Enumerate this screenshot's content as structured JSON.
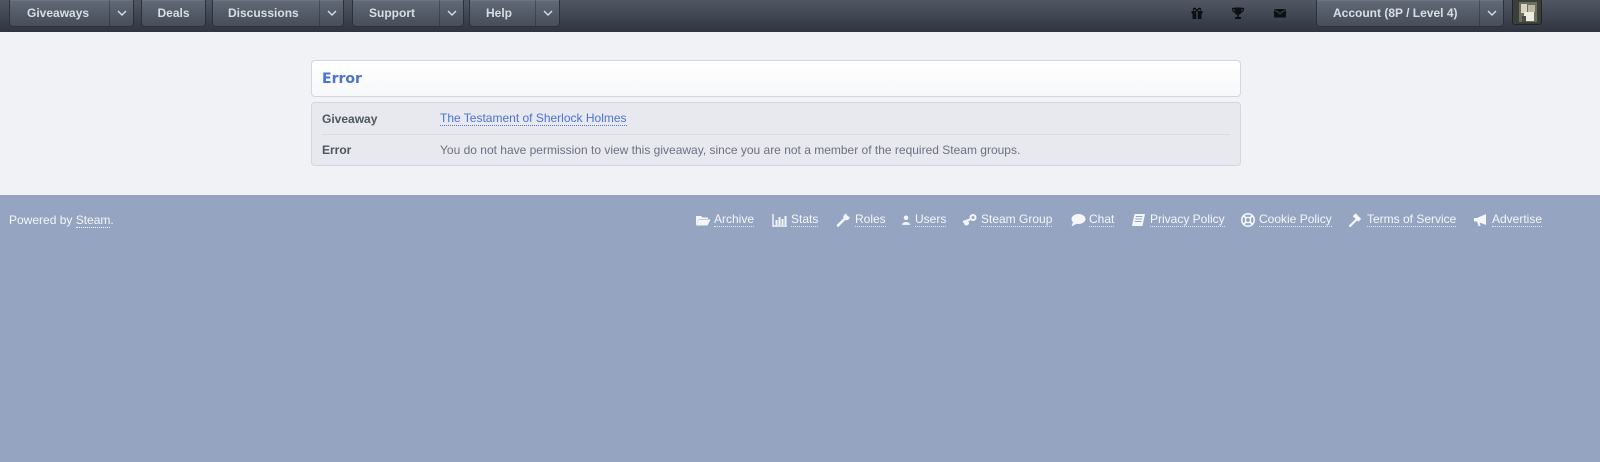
{
  "header": {
    "nav": [
      {
        "label": "Giveaways",
        "has_dropdown": true
      },
      {
        "label": "Deals",
        "has_dropdown": false
      },
      {
        "label": "Discussions",
        "has_dropdown": true
      },
      {
        "label": "Support",
        "has_dropdown": true
      },
      {
        "label": "Help",
        "has_dropdown": true
      }
    ],
    "icons": [
      "gift-icon",
      "trophy-icon",
      "envelope-icon"
    ],
    "account_label": "Account (8P / Level 4)"
  },
  "page": {
    "heading": "Error",
    "rows": [
      {
        "key": "Giveaway",
        "value": "The Testament of Sherlock Holmes"
      },
      {
        "key": "Error",
        "value": "You do not have permission to view this giveaway, since you are not a member of the required Steam groups."
      }
    ]
  },
  "footer": {
    "powered_prefix": "Powered by ",
    "powered_link": "Steam",
    "powered_suffix": ".",
    "links": [
      "Archive",
      "Stats",
      "Roles",
      "Users",
      "Steam Group",
      "Chat",
      "Privacy Policy",
      "Cookie Policy",
      "Terms of Service",
      "Advertise"
    ]
  },
  "colors": {
    "header_bg": "#3a404b",
    "content_bg": "#f0f2f5",
    "footer_bg": "#95a4c0",
    "accent": "#4b72d4"
  }
}
